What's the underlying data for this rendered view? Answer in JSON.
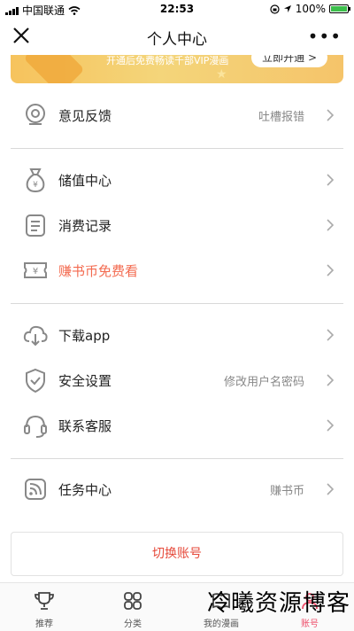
{
  "status_bar": {
    "carrier": "中国联通",
    "time": "22:53",
    "battery": "100%",
    "battery_level": 1.0
  },
  "nav": {
    "title": "个人中心",
    "more": "•••"
  },
  "banner": {
    "text": "开通后免费畅读千部VIP漫画",
    "button": "立即开通 >"
  },
  "menu": {
    "feedback": {
      "label": "意见反馈",
      "extra": "吐槽报错"
    },
    "recharge": {
      "label": "储值中心"
    },
    "records": {
      "label": "消费记录"
    },
    "free_read": {
      "label": "赚书币免费看"
    },
    "download": {
      "label": "下载app"
    },
    "security": {
      "label": "安全设置",
      "extra": "修改用户名密码"
    },
    "service": {
      "label": "联系客服"
    },
    "tasks": {
      "label": "任务中心",
      "extra": "赚书币"
    }
  },
  "switch_account": "切换账号",
  "tabs": [
    {
      "label": "推荐",
      "icon": "trophy-icon"
    },
    {
      "label": "分类",
      "icon": "category-icon"
    },
    {
      "label": "我的漫画",
      "icon": "book-icon"
    },
    {
      "label": "账号",
      "icon": "account-icon"
    }
  ],
  "watermark": "冷曦资源博客",
  "colors": {
    "accent_red": "#e64a3b",
    "free_read": "#f36a4f",
    "banner": "#f6c35d",
    "tab_active": "#ee4e6a"
  }
}
